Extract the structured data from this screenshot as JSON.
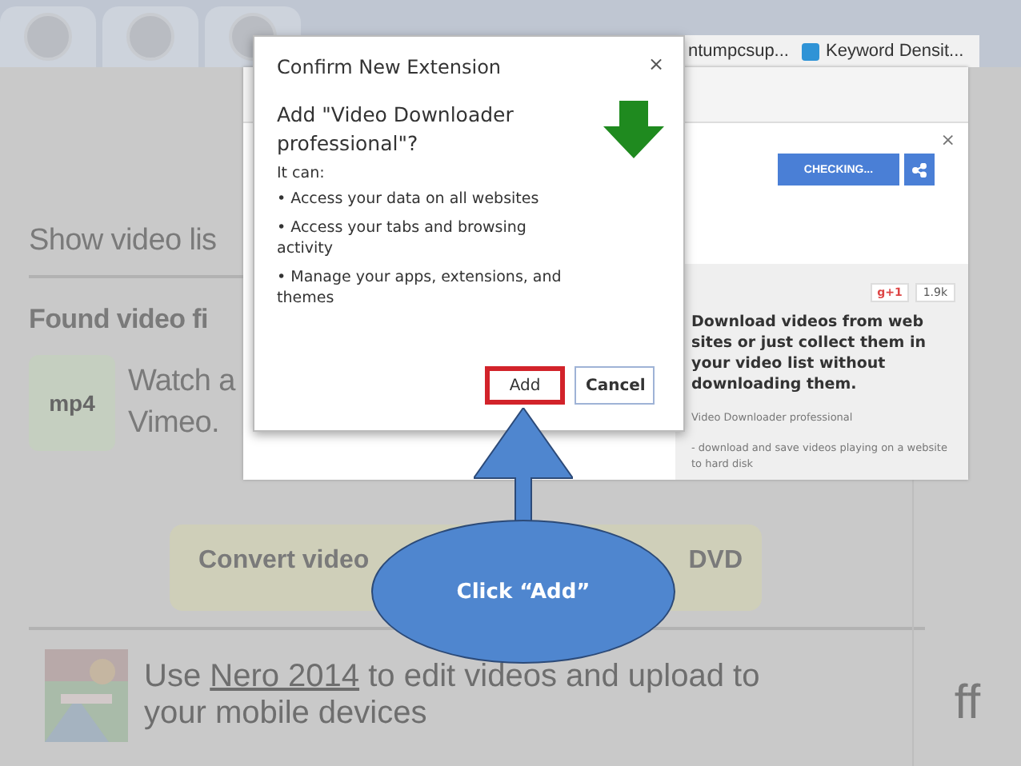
{
  "browser": {
    "bookmarks": [
      {
        "label": "ntumpcsup...",
        "has_icon": false
      },
      {
        "label": "Keyword Densit...",
        "has_icon": true
      }
    ]
  },
  "background_page": {
    "show_list": "Show video lis",
    "found_heading": "Found video fi",
    "video": {
      "format": "mp4",
      "title_lines": [
        "Watch a",
        "Vimeo."
      ]
    },
    "convert_button": {
      "left": "Convert video",
      "right": "DVD"
    },
    "promo": {
      "before": "Use",
      "link": "Nero 2014",
      "after": "to edit videos and upload to",
      "line_2": "your mobile devices"
    },
    "side_text": "ff"
  },
  "store_panel": {
    "close": "×",
    "checking_button": "CHECKING...",
    "gplus": "g+1",
    "count": "1.9k",
    "description": "Download videos from web sites or just collect them in your video list without downloading them.",
    "name": "Video Downloader professional",
    "feature": "- download and save videos playing on a website to hard disk"
  },
  "dialog": {
    "title": "Confirm New Extension",
    "close": "×",
    "heading": "Add \"Video Downloader professional\"?",
    "intro": "It can:",
    "permissions": [
      "• Access your data on all websites",
      "• Access your tabs and browsing activity",
      "• Manage your apps, extensions, and themes"
    ],
    "buttons": [
      {
        "label": "Add",
        "highlighted": true
      },
      {
        "label": "Cancel",
        "highlighted": false
      }
    ]
  },
  "callout": {
    "text": "Click “Add”"
  }
}
